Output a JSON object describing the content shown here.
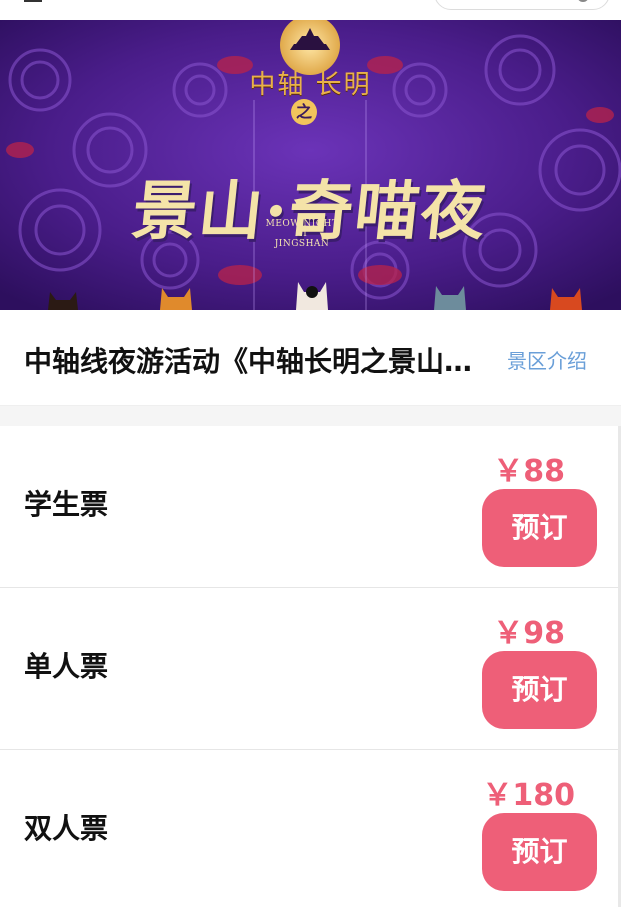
{
  "banner": {
    "title_top": "中轴 长明",
    "title_connector": "之",
    "title_main": "景山·奇喵夜",
    "subtitle_en": [
      "MEOW NIGHT",
      "AT",
      "JINGSHAN"
    ],
    "colors": {
      "background": "#4a1d8a",
      "title": "#f4e3a8",
      "accent": "#e8b14a"
    }
  },
  "header": {
    "title": "中轴线夜游活动《中轴长明之景山·奇喵夜》",
    "intro_link": "景区介绍"
  },
  "tickets": [
    {
      "name": "学生票",
      "price": "￥88",
      "button": "预订"
    },
    {
      "name": "单人票",
      "price": "￥98",
      "button": "预订"
    },
    {
      "name": "双人票",
      "price": "￥180",
      "button": "预订"
    }
  ],
  "theme": {
    "accent": "#ee5f78",
    "link": "#6a9fd8"
  }
}
